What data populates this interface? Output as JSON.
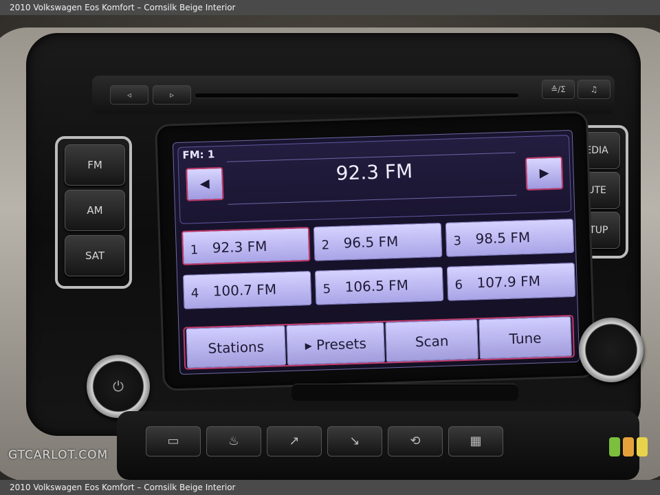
{
  "caption": {
    "top": "2010 Volkswagen Eos Komfort – Cornsilk Beige Interior",
    "bottom": "2010 Volkswagen Eos Komfort – Cornsilk Beige Interior"
  },
  "watermark": "GTCARLOT.COM",
  "hardware": {
    "left_buttons": [
      "FM",
      "AM",
      "SAT"
    ],
    "right_buttons": [
      "MEDIA",
      "MUTE",
      "SETUP"
    ],
    "cd_row": {
      "prev": "◃",
      "next": "▹",
      "eject": "≙/Σ",
      "music": "♫"
    }
  },
  "screen": {
    "band": "FM: 1",
    "current_frequency": "92.3 FM",
    "prev_arrow": "◀",
    "next_arrow": "▶",
    "presets": [
      {
        "num": "1",
        "label": "92.3 FM",
        "selected": true
      },
      {
        "num": "2",
        "label": "96.5 FM",
        "selected": false
      },
      {
        "num": "3",
        "label": "98.5 FM",
        "selected": false
      },
      {
        "num": "4",
        "label": "100.7 FM",
        "selected": false
      },
      {
        "num": "5",
        "label": "106.5 FM",
        "selected": false
      },
      {
        "num": "6",
        "label": "107.9 FM",
        "selected": false
      }
    ],
    "tabs": [
      "Stations",
      "▸ Presets",
      "Scan",
      "Tune"
    ]
  },
  "colors": {
    "screen_bg": "#1a1530",
    "button_lavender": "#c8c4ff",
    "highlight_border": "#c23a6a"
  }
}
